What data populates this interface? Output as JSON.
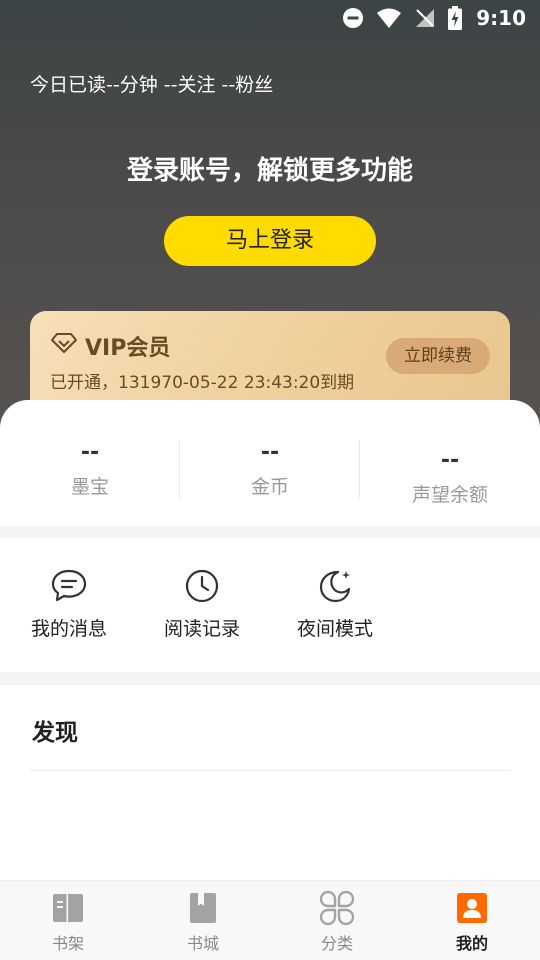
{
  "status_bar": {
    "time": "9:10"
  },
  "header": {
    "stats_text": "今日已读--分钟 --关注 --粉丝",
    "login_title": "登录账号，解锁更多功能",
    "login_button": "马上登录"
  },
  "vip": {
    "title": "VIP会员",
    "subtitle": "已开通，131970-05-22 23:43:20到期",
    "renew_button": "立即续费"
  },
  "stats": [
    {
      "value": "--",
      "label": "墨宝"
    },
    {
      "value": "--",
      "label": "金币"
    },
    {
      "value": "--",
      "label": "声望余额"
    }
  ],
  "tools": [
    {
      "label": "我的消息",
      "icon": "message-icon"
    },
    {
      "label": "阅读记录",
      "icon": "clock-icon"
    },
    {
      "label": "夜间模式",
      "icon": "moon-icon"
    }
  ],
  "discover": {
    "title": "发现"
  },
  "tabs": [
    {
      "label": "书架",
      "icon": "bookshelf-icon"
    },
    {
      "label": "书城",
      "icon": "bookstore-icon"
    },
    {
      "label": "分类",
      "icon": "category-icon"
    },
    {
      "label": "我的",
      "icon": "profile-icon",
      "active": true
    }
  ],
  "colors": {
    "accent": "#ffdb00",
    "active_tab": "#ff6a00",
    "vip_text": "#6a4a22"
  }
}
